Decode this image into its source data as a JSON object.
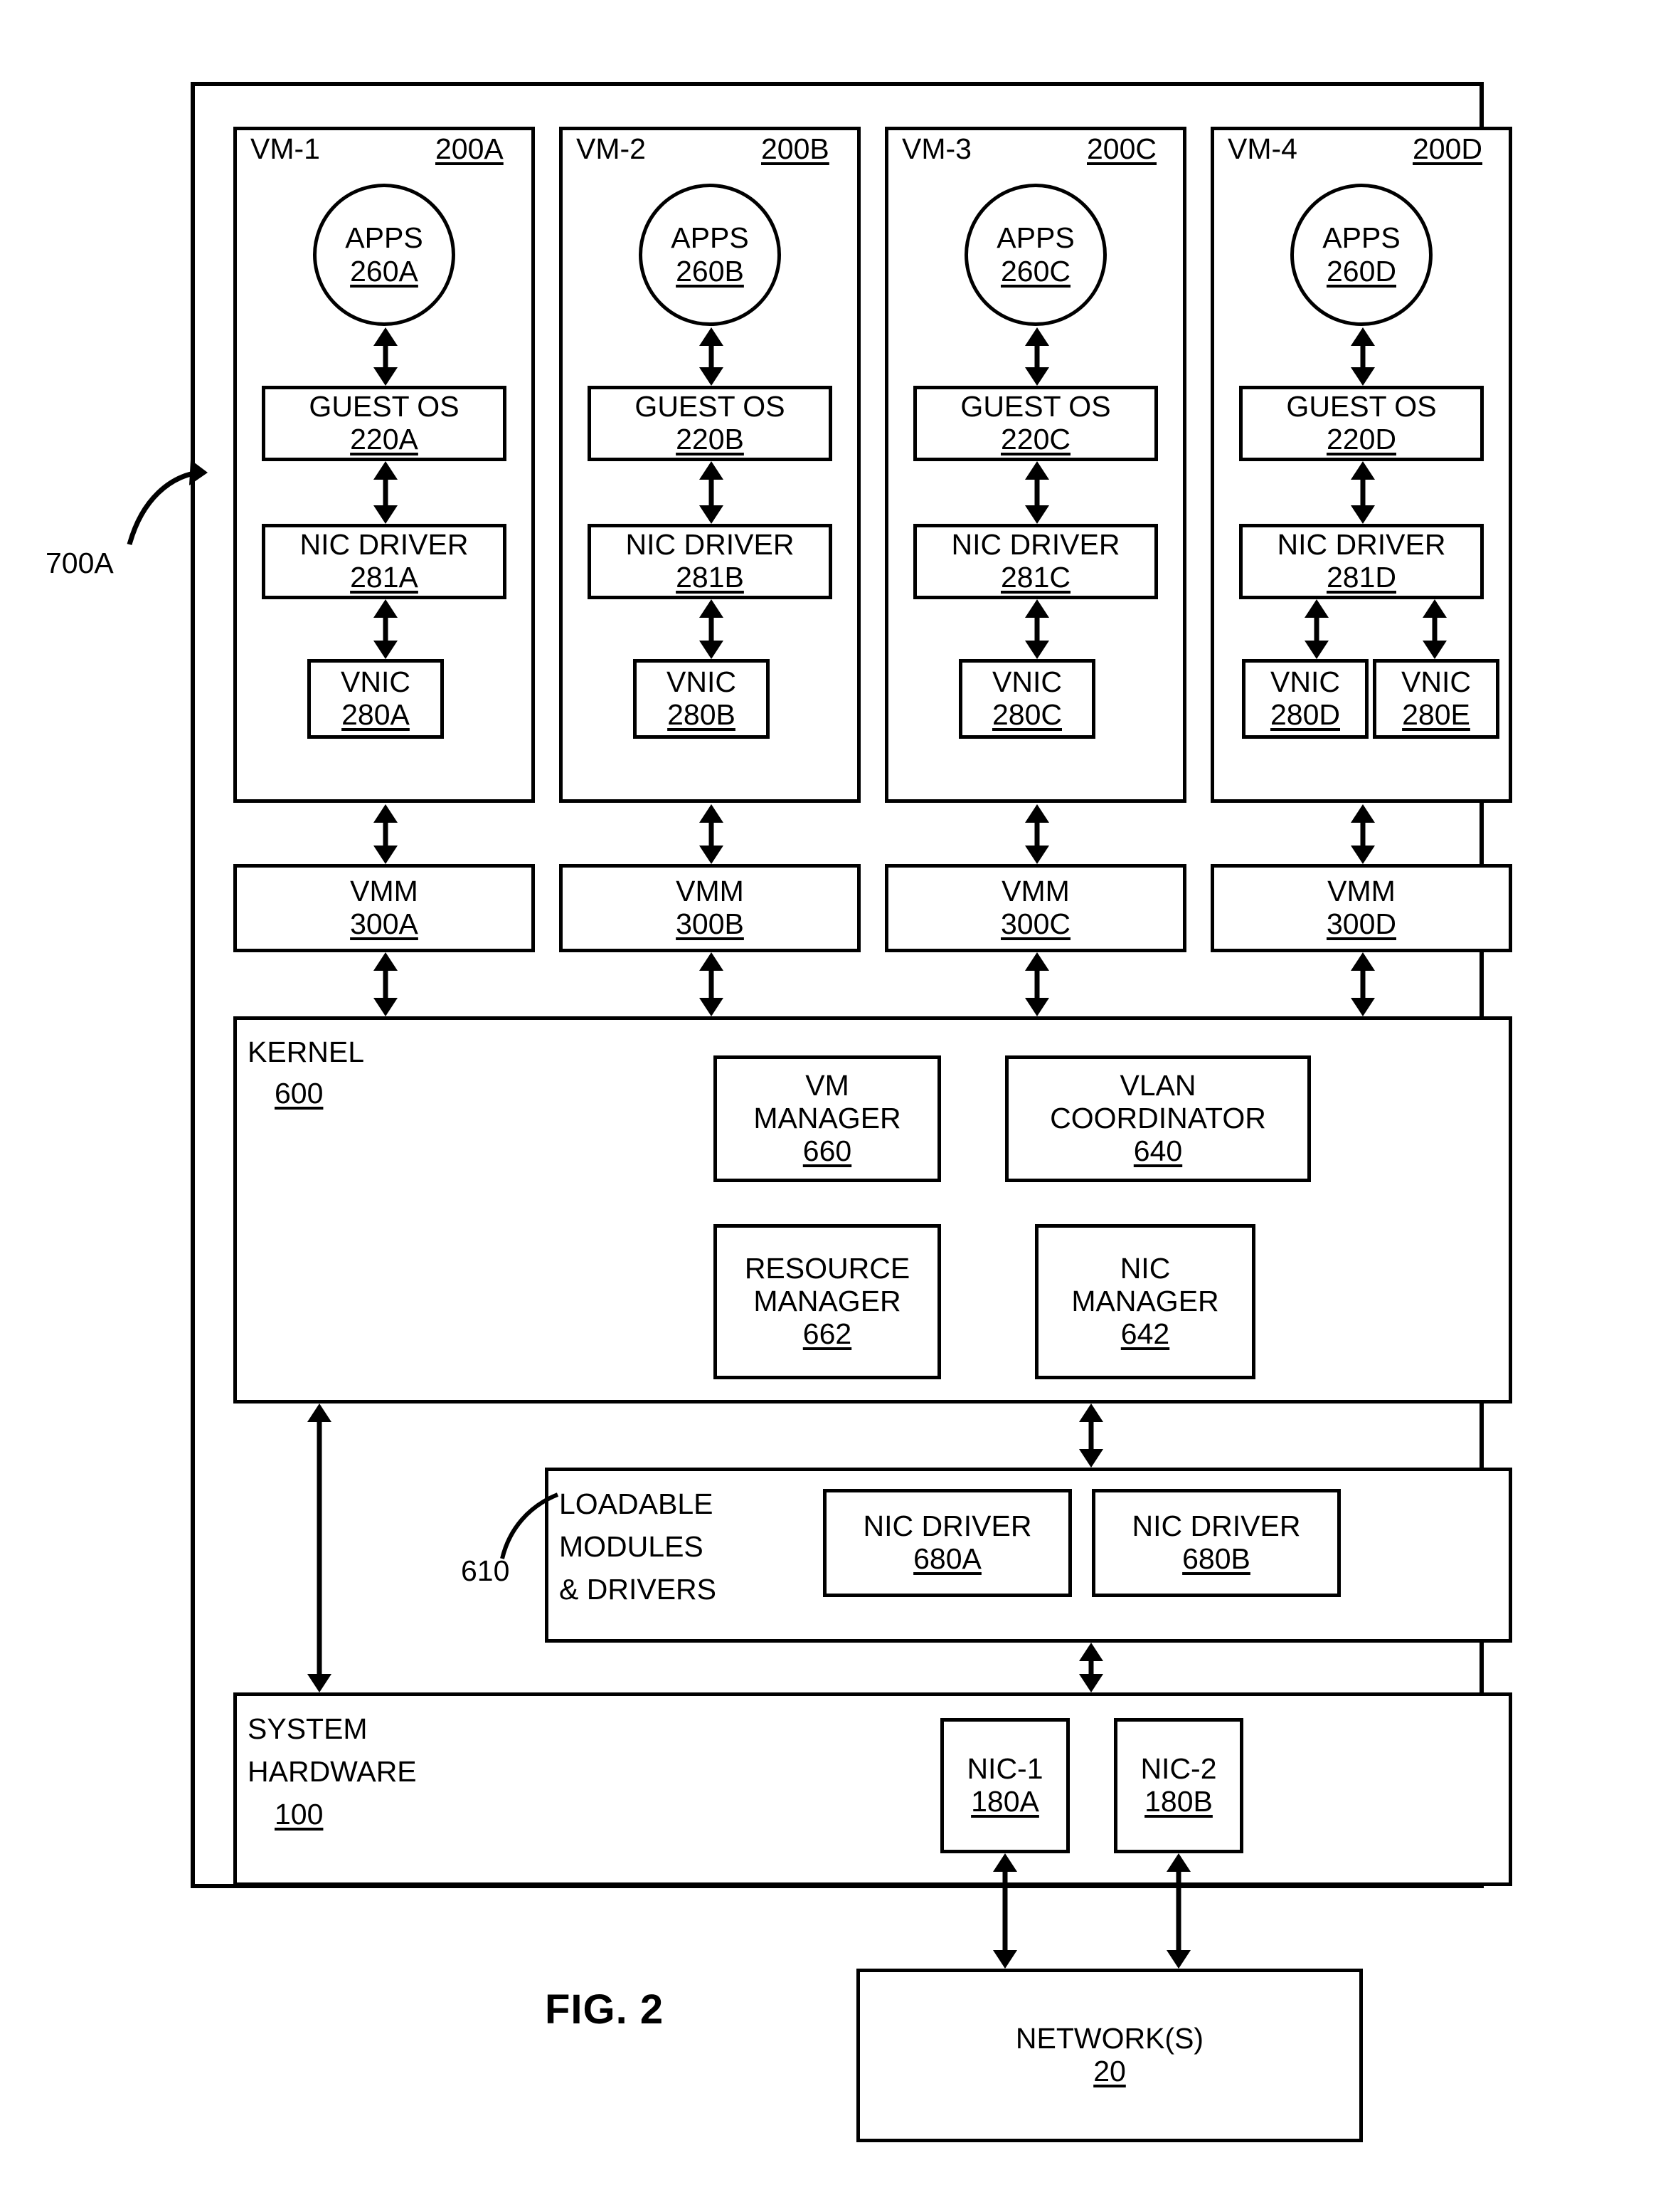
{
  "figure": {
    "caption": "FIG. 2",
    "system_ref": "700A",
    "loadable_ref": "610"
  },
  "vms": [
    {
      "title": "VM-1",
      "ref": "200A",
      "apps": {
        "label": "APPS",
        "ref": "260A"
      },
      "guest_os": {
        "label": "GUEST OS",
        "ref": "220A"
      },
      "nic_driver": {
        "label": "NIC DRIVER",
        "ref": "281A"
      },
      "vnics": [
        {
          "label": "VNIC",
          "ref": "280A"
        }
      ],
      "vmm": {
        "label": "VMM",
        "ref": "300A"
      }
    },
    {
      "title": "VM-2",
      "ref": "200B",
      "apps": {
        "label": "APPS",
        "ref": "260B"
      },
      "guest_os": {
        "label": "GUEST OS",
        "ref": "220B"
      },
      "nic_driver": {
        "label": "NIC DRIVER",
        "ref": "281B"
      },
      "vnics": [
        {
          "label": "VNIC",
          "ref": "280B"
        }
      ],
      "vmm": {
        "label": "VMM",
        "ref": "300B"
      }
    },
    {
      "title": "VM-3",
      "ref": "200C",
      "apps": {
        "label": "APPS",
        "ref": "260C"
      },
      "guest_os": {
        "label": "GUEST OS",
        "ref": "220C"
      },
      "nic_driver": {
        "label": "NIC DRIVER",
        "ref": "281C"
      },
      "vnics": [
        {
          "label": "VNIC",
          "ref": "280C"
        }
      ],
      "vmm": {
        "label": "VMM",
        "ref": "300C"
      }
    },
    {
      "title": "VM-4",
      "ref": "200D",
      "apps": {
        "label": "APPS",
        "ref": "260D"
      },
      "guest_os": {
        "label": "GUEST OS",
        "ref": "220D"
      },
      "nic_driver": {
        "label": "NIC DRIVER",
        "ref": "281D"
      },
      "vnics": [
        {
          "label": "VNIC",
          "ref": "280D"
        },
        {
          "label": "VNIC",
          "ref": "280E"
        }
      ],
      "vmm": {
        "label": "VMM",
        "ref": "300D"
      }
    }
  ],
  "kernel": {
    "title": "KERNEL",
    "ref": "600",
    "modules": [
      {
        "line1": "VM",
        "line2": "MANAGER",
        "ref": "660"
      },
      {
        "line1": "VLAN",
        "line2": "COORDINATOR",
        "ref": "640"
      },
      {
        "line1": "RESOURCE",
        "line2": "MANAGER",
        "ref": "662"
      },
      {
        "line1": "NIC",
        "line2": "MANAGER",
        "ref": "642"
      }
    ]
  },
  "loadable": {
    "line1": "LOADABLE",
    "line2": "MODULES",
    "line3": "& DRIVERS",
    "ref": "610",
    "drivers": [
      {
        "label": "NIC DRIVER",
        "ref": "680A"
      },
      {
        "label": "NIC DRIVER",
        "ref": "680B"
      }
    ]
  },
  "system_hardware": {
    "line1": "SYSTEM",
    "line2": "HARDWARE",
    "ref": "100",
    "nics": [
      {
        "label": "NIC-1",
        "ref": "180A"
      },
      {
        "label": "NIC-2",
        "ref": "180B"
      }
    ]
  },
  "network": {
    "label": "NETWORK(S)",
    "ref": "20"
  }
}
